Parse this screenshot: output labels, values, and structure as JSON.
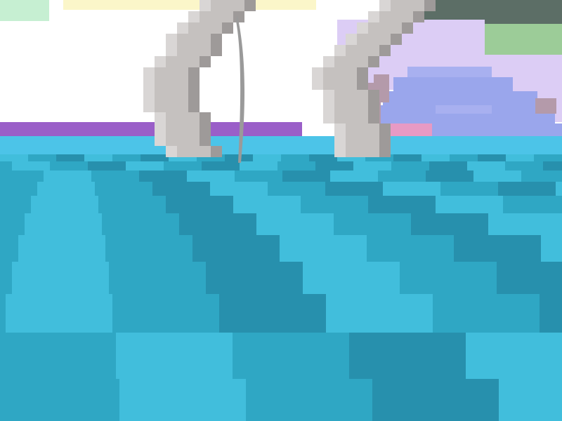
{
  "scene": {
    "style": "voxel-first-person",
    "colors": {
      "sky": "#ffffff",
      "sky_tint_green": "#c6efd2",
      "sky_tint_yellow": "#fbf6c9",
      "dark_cloud": "#5c6e66",
      "green_cloud": "#9ccc98",
      "lavender_cloud": "#dccdf5",
      "purple_shore": "#9a5fc8",
      "distant_hill": "#9aa6ec",
      "hill_top": "#a8b0f0",
      "pink_strip": "#e79ac4",
      "trunk": "#b49aaa",
      "horizon_water": "#4cc4e8",
      "water_light": "#41bedc",
      "water_mid": "#2fa7c4",
      "water_dark": "#2790ad",
      "bone_light": "#d9d6d5",
      "bone_mid": "#c5c1bf",
      "bone_shadow": "#9e9a99",
      "spike": "#9a9a9a"
    },
    "objects": [
      {
        "name": "left-bone-arch",
        "kind": "blocky-bone"
      },
      {
        "name": "right-bone-arch",
        "kind": "blocky-bone"
      },
      {
        "name": "thin-spike",
        "kind": "sword-like-spike"
      },
      {
        "name": "distant-island",
        "kind": "hill"
      },
      {
        "name": "coral-tree",
        "kind": "trunk"
      }
    ]
  }
}
